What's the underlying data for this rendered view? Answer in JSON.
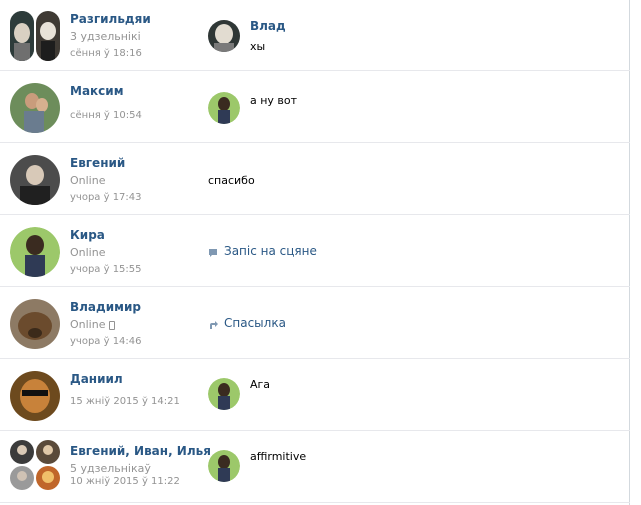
{
  "conversations": [
    {
      "name": "Разгильдяи",
      "line1": "3 удзельнікі",
      "time": "сёння ў 18:16",
      "msg_author": "Влад",
      "msg_text": "хы"
    },
    {
      "name": "Максим",
      "time": "сёння ў 10:54",
      "msg_text": "а ну вот"
    },
    {
      "name": "Евгений",
      "status": "Online",
      "time": "учора ў 17:43",
      "msg_text": "спасибо"
    },
    {
      "name": "Кира",
      "status": "Online",
      "time": "учора ў 15:55",
      "msg_text": "Запіс на сцяне"
    },
    {
      "name": "Владимир",
      "status": "Online",
      "time": "учора ў 14:46",
      "msg_text": "Спасылка"
    },
    {
      "name": "Даниил",
      "time": "15 жніў 2015 ў 14:21",
      "msg_text": "Ага"
    },
    {
      "name": "Евгений, Иван, Илья",
      "line1": "5 удзельнікаў",
      "time": "10 жніў 2015 ў 11:22",
      "msg_text": "affirmitive"
    }
  ],
  "icons": {
    "wall_post": "speech-bubble-icon",
    "link": "share-arrow-icon",
    "mobile": "phone-icon"
  },
  "colors": {
    "link": "#2a5885",
    "muted": "#939393",
    "divider": "#e7e8ec"
  }
}
